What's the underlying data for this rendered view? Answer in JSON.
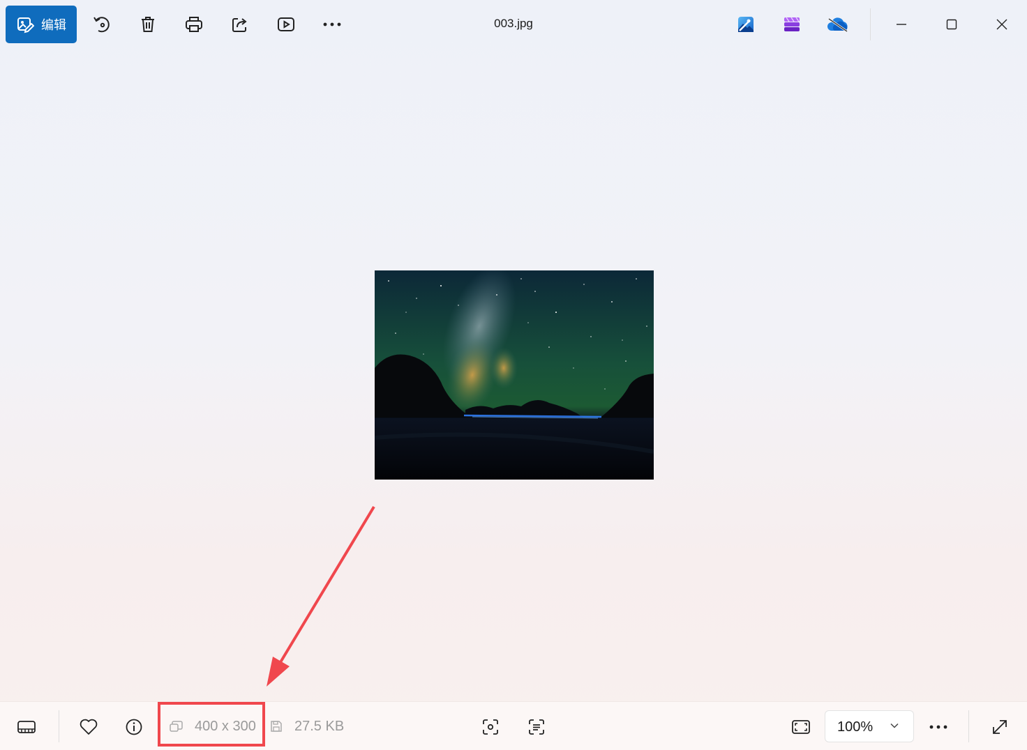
{
  "toolbar": {
    "edit_label": "编辑",
    "file_name": "003.jpg"
  },
  "window_controls": {
    "minimize": "minimize",
    "maximize": "maximize",
    "close": "close"
  },
  "status": {
    "dimensions": "400 x 300",
    "file_size": "27.5 KB",
    "zoom": "100%"
  },
  "colors": {
    "accent": "#0f6cbd",
    "annotation": "#f0474d"
  },
  "icons": [
    "edit-image-icon",
    "rotate-icon",
    "delete-icon",
    "print-icon",
    "share-icon",
    "slideshow-icon",
    "more-icon",
    "photos-app-icon",
    "clipchamp-icon",
    "onedrive-icon",
    "filmstrip-icon",
    "favorite-heart-icon",
    "info-icon",
    "dimensions-icon",
    "file-size-icon",
    "visual-search-icon",
    "text-recognition-icon",
    "fit-to-window-icon",
    "chevron-down-icon",
    "fullscreen-icon"
  ]
}
